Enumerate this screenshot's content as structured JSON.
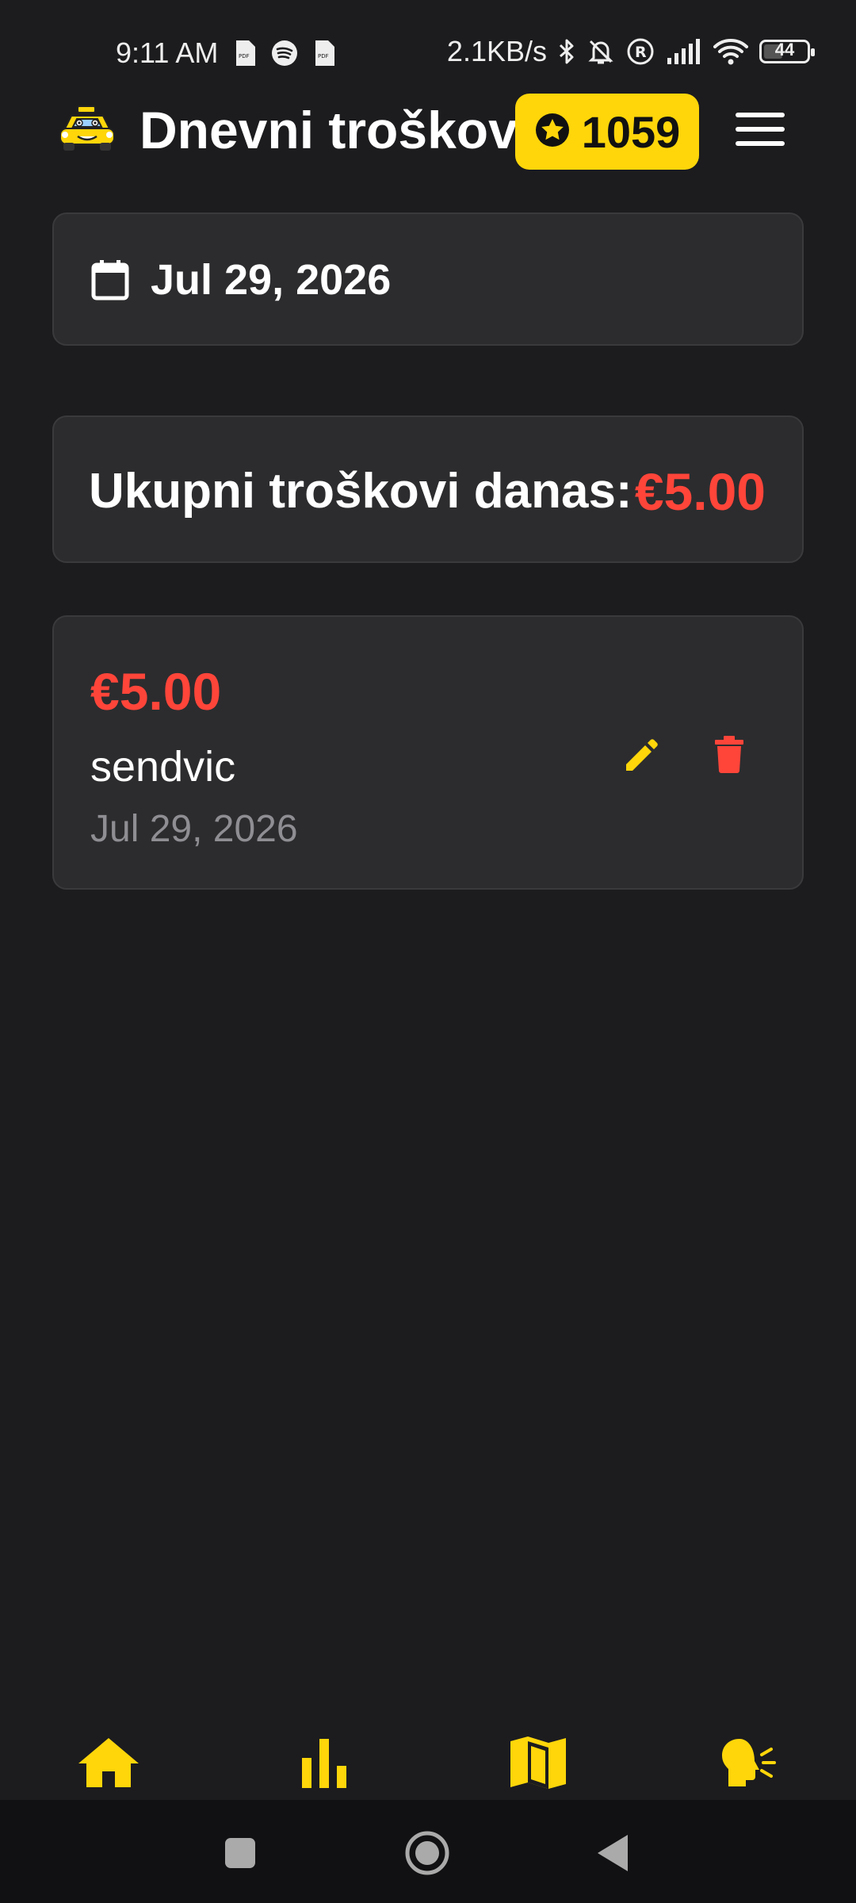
{
  "status_bar": {
    "time": "9:11 AM",
    "speed": "2.1KB/s",
    "battery": "44",
    "battery_level": 0.44,
    "left_icons": [
      "pdf-icon",
      "spotify-icon",
      "pdf-icon"
    ],
    "right_icons": [
      "bluetooth-icon",
      "mute-bell-icon",
      "registered-icon",
      "signal-icon",
      "wifi-icon",
      "battery-icon"
    ]
  },
  "header": {
    "title": "Dnevni troškovi",
    "points": "1059",
    "logo_icon": "taxi-car-logo",
    "menu_icon": "hamburger-menu-icon"
  },
  "date_selector": {
    "icon": "calendar-icon",
    "date": "Jul 29, 2026"
  },
  "total": {
    "label": "Ukupni troškovi danas:",
    "amount": "€5.00"
  },
  "expenses": [
    {
      "amount": "€5.00",
      "description": "sendvic",
      "date": "Jul 29, 2026"
    }
  ],
  "bottom_nav": {
    "items": [
      "home-icon",
      "stats-bar-chart-icon",
      "map-icon",
      "speaking-head-icon"
    ]
  },
  "colors": {
    "background": "#1c1c1e",
    "card": "#2c2c2e",
    "accent": "#ffd60a",
    "expense_red": "#ff453a",
    "muted": "#8e8e93"
  }
}
